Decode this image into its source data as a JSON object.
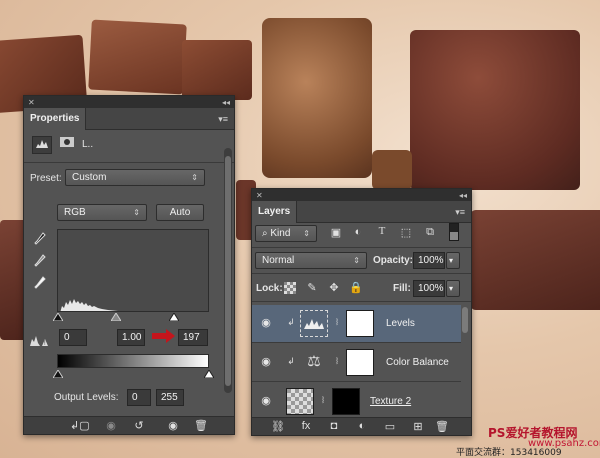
{
  "properties": {
    "tab_label": "Properties",
    "icon_label": "L..",
    "preset_label": "Preset:",
    "preset_value": "Custom",
    "channel_value": "RGB",
    "auto_label": "Auto",
    "input_black": "0",
    "input_gamma": "1.00",
    "input_white": "197",
    "output_label": "Output Levels:",
    "output_black": "0",
    "output_white": "255"
  },
  "layers": {
    "tab_label": "Layers",
    "filter_kind": "Kind",
    "blend_mode": "Normal",
    "opacity_label": "Opacity:",
    "opacity_value": "100%",
    "lock_label": "Lock:",
    "fill_label": "Fill:",
    "fill_value": "100%",
    "rows": [
      {
        "name": "Levels"
      },
      {
        "name": "Color Balance"
      },
      {
        "name": "Texture 2"
      }
    ]
  },
  "watermark": {
    "line1": "PS爱好者教程网",
    "line2": "www.psahz.com",
    "line3": "平面交流群：",
    "line4": "153416009"
  },
  "accent": "#c4151c",
  "selection": "#58677a"
}
